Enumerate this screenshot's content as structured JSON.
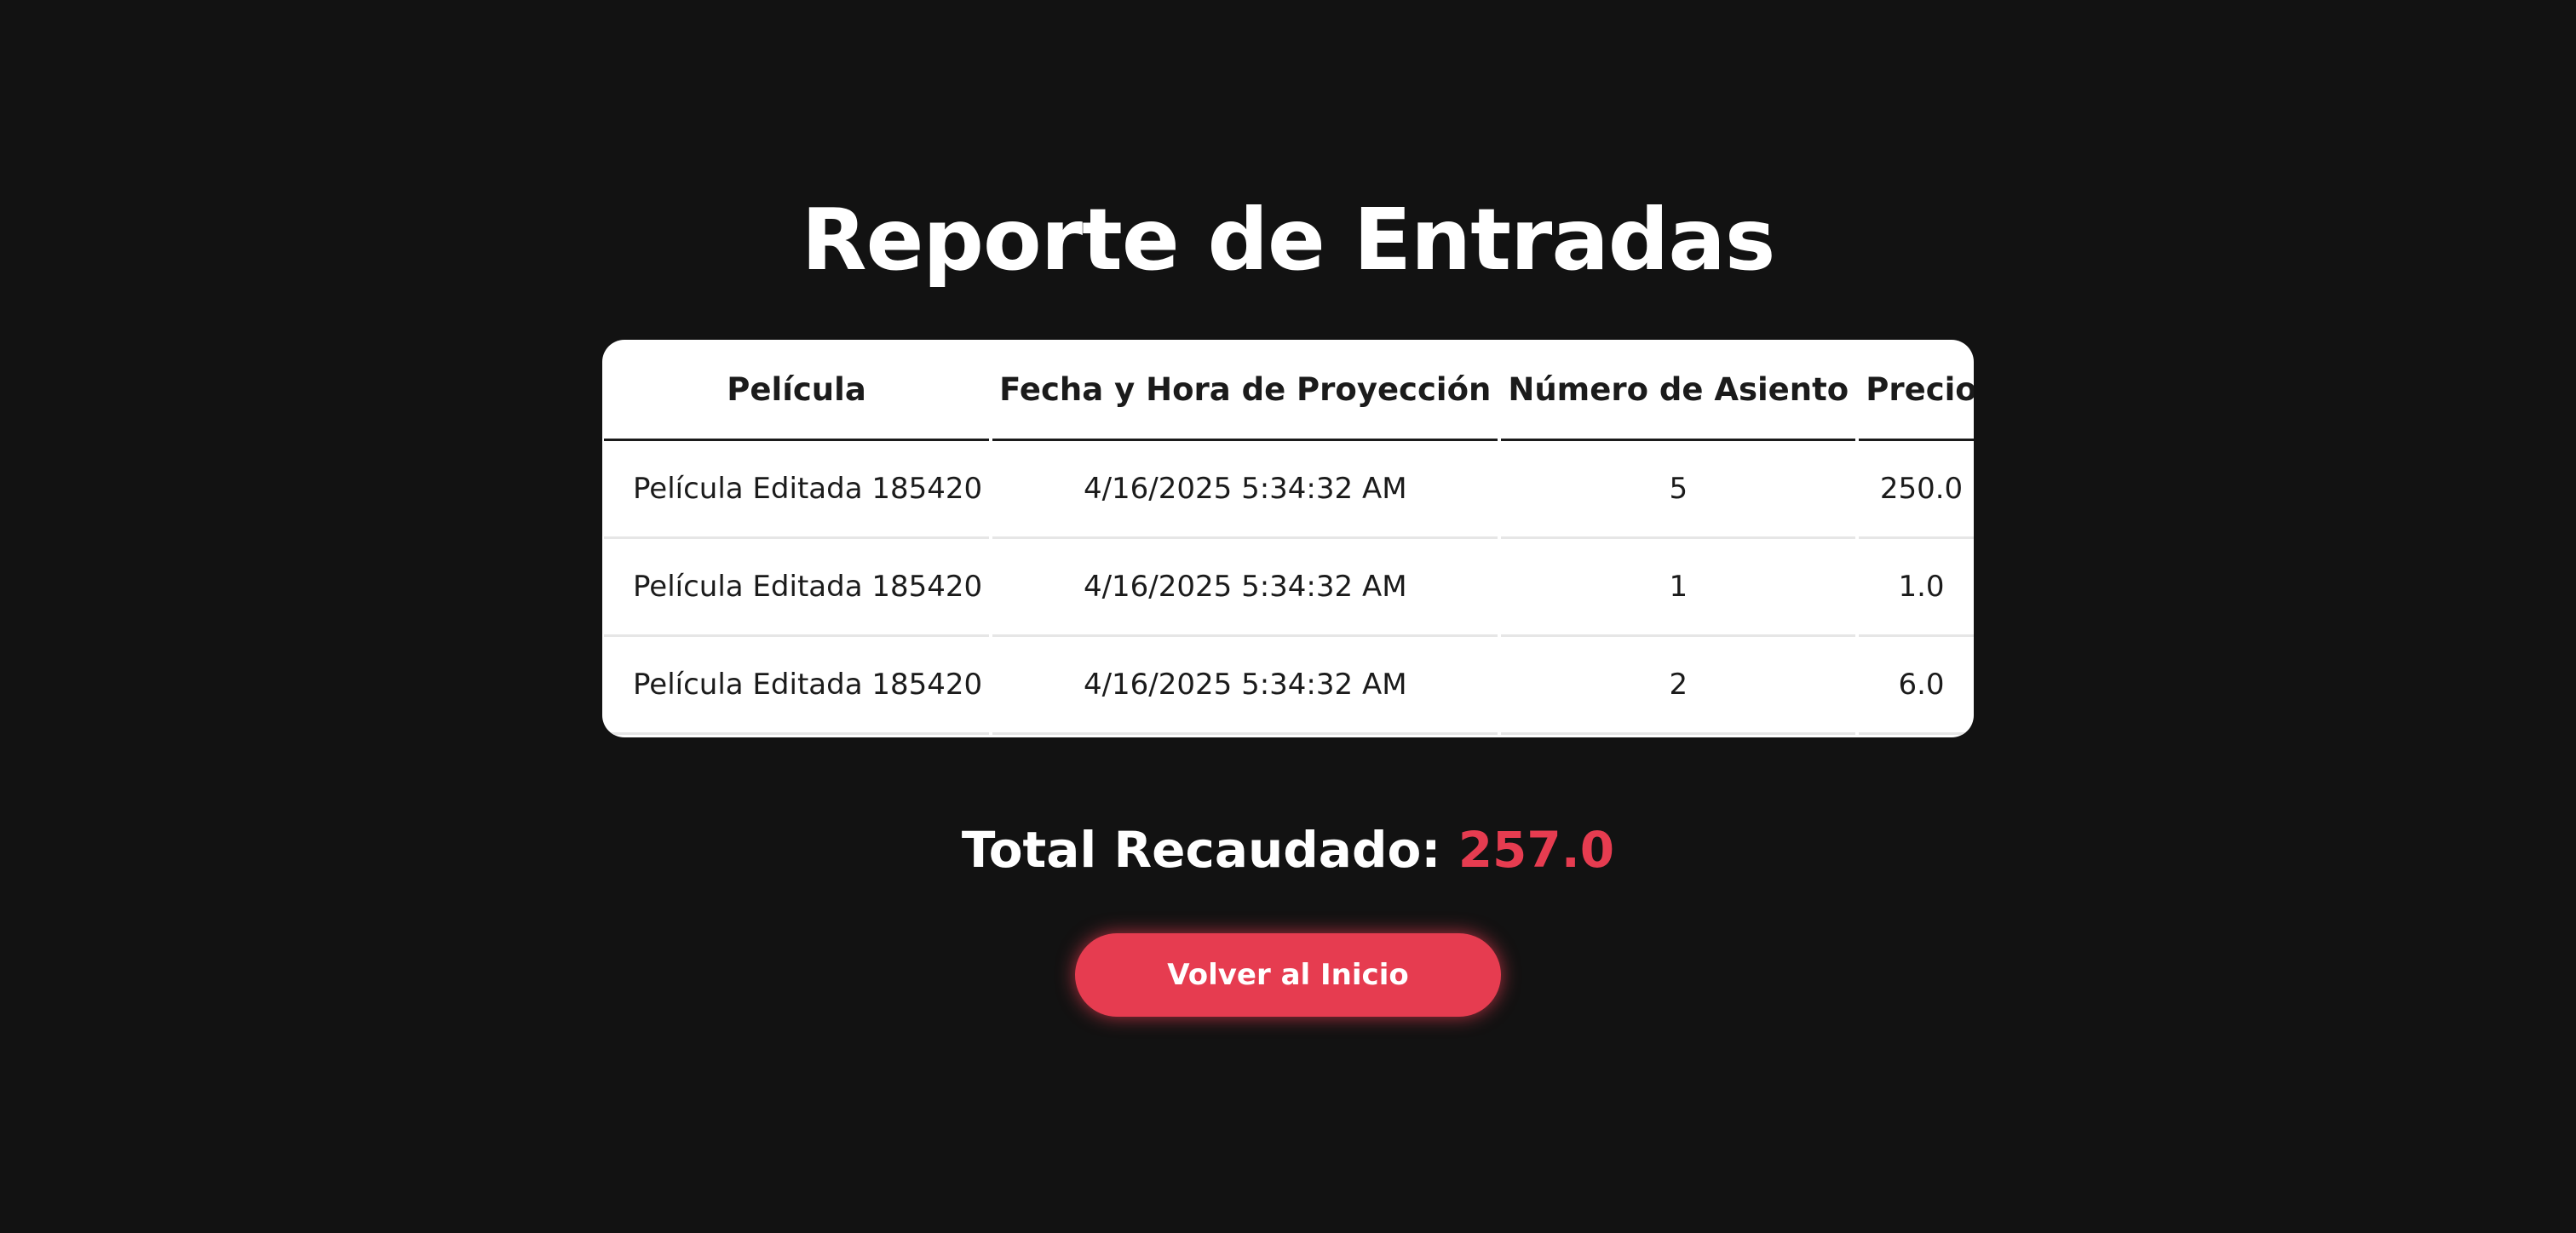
{
  "page": {
    "title": "Reporte de Entradas"
  },
  "table": {
    "headers": [
      "Película",
      "Fecha y Hora de Proyección",
      "Número de Asiento",
      "Precio"
    ],
    "rows": [
      [
        "Película Editada 185420",
        "4/16/2025 5:34:32 AM",
        "5",
        "250.0"
      ],
      [
        "Película Editada 185420",
        "4/16/2025 5:34:32 AM",
        "1",
        "1.0"
      ],
      [
        "Película Editada 185420",
        "4/16/2025 5:34:32 AM",
        "2",
        "6.0"
      ]
    ]
  },
  "summary": {
    "label": "Total Recaudado:",
    "amount": "257.0"
  },
  "actions": {
    "back_label": "Volver al Inicio"
  },
  "colors": {
    "background": "#121212",
    "accent": "#e63c50",
    "card": "#ffffff",
    "text_dark": "#1b1b1b"
  }
}
